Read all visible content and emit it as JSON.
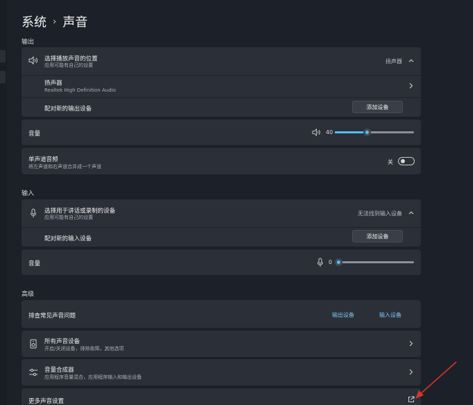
{
  "breadcrumb": {
    "parent": "系统",
    "separator": "›",
    "current": "声音"
  },
  "output": {
    "section_label": "输出",
    "choose_title": "选择播放声音的位置",
    "choose_sub": "应用可能有自己的设置",
    "choose_status": "扬声器",
    "device_name": "扬声器",
    "device_detail": "Realtek High Definition Audio",
    "pair_label": "配对新的输出设备",
    "add_button": "添加设备",
    "volume_label": "音量",
    "volume_value": "40",
    "volume_level": 0.4,
    "mono_title": "单声道音频",
    "mono_sub": "将左声道和右声道合并成一个声道",
    "mono_state": "关"
  },
  "input": {
    "section_label": "输入",
    "choose_title": "选择用于讲话或录制的设备",
    "choose_sub": "应用可能有自己的设置",
    "choose_status": "无法找到输入设备",
    "pair_label": "配对新的输入设备",
    "add_button": "添加设备",
    "volume_label": "音量",
    "volume_value": "0",
    "volume_level": 0
  },
  "advanced": {
    "section_label": "高级",
    "troubleshoot_label": "排查常见声音问题",
    "output_device_link": "输出设备",
    "input_device_link": "输入设备",
    "all_devices_title": "所有声音设备",
    "all_devices_sub": "开启/关闭设备，排除故障，其他选项",
    "mixer_title": "音量合成器",
    "mixer_sub": "应用程序音量混合，应用程序输入和输出设备",
    "more_settings": "更多声音设置"
  },
  "colors": {
    "accent": "#4cc2ff",
    "card": "#2b2f38",
    "background": "#1c2028",
    "annotation": "#d9342b"
  }
}
